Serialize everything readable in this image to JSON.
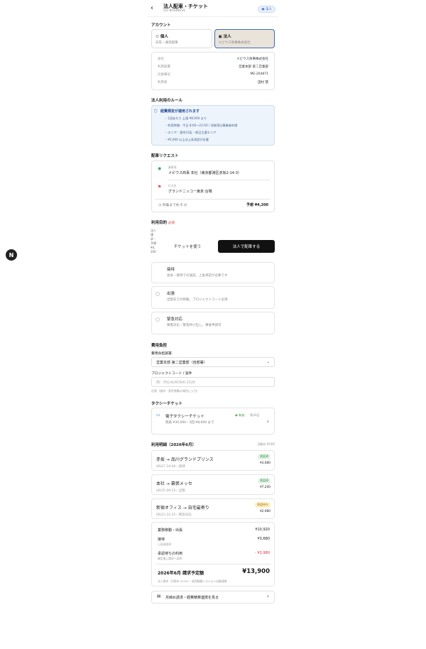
{
  "header": {
    "title": "法人配車・チケット",
    "subtitle": "GO BUSINESS",
    "badge": "法人"
  },
  "account": {
    "section": "アカウント",
    "personal_title": "個人",
    "personal_sub": "日常・通常配車",
    "corporate_title": "法人",
    "corporate_sub": "メビウス商事株式会社",
    "info": [
      {
        "k": "会社",
        "v": "メビウス商事株式会社"
      },
      {
        "k": "利用部署",
        "v": "営業本部 第二営業部"
      },
      {
        "k": "社員番号",
        "v": "ME-204871"
      },
      {
        "k": "利用者",
        "v": "田村 慧"
      }
    ]
  },
  "rules": {
    "section": "法人利用のルール",
    "title": "経費規定が適用されます",
    "items": [
      "・1回あたり 上限 ¥8,000 まで",
      "・利用時間：平日 8:00〜22:00 / 深夜帯は事業者申請",
      "・エリア：東京23区・周辺主要エリア",
      "・¥5,000 以上は上長承認が必要"
    ]
  },
  "request": {
    "section": "配車リクエスト",
    "pickup_label": "乗車地",
    "pickup": "メビウス商事 本社（東京都港区赤坂2-14-3）",
    "dest_label": "行き先",
    "dest": "グランドニッコー東京 台場",
    "eta": "到着まで約 6 分",
    "estimate": "予想 ¥4,200"
  },
  "purpose": {
    "section": "利用目的",
    "required": "必須",
    "side_text": "法人請求・予想 ¥4,200",
    "ticket_button": "チケットを使う",
    "corp_button": "法人で配車する",
    "options": [
      {
        "title": "接待",
        "sub": "会食・接待での送迎。上長承認が必要です"
      },
      {
        "title": "出張",
        "sub": "出張先での移動。プロジェクトコード必須"
      },
      {
        "title": "緊急対応",
        "sub": "障害対応・緊急呼び出し。事後申請可"
      }
    ]
  },
  "cost": {
    "section": "費用負担",
    "dept_label": "費用負担部署",
    "dept_value": "営業本部 第二営業部（自部署）",
    "project_label": "プロジェクトコード / 案件",
    "project_placeholder": "例：PRJ-AURORA-2026",
    "note": "任意（接待・案件移動の場合に入力）"
  },
  "ticket": {
    "section": "タクシーチケット",
    "title": "電子タクシーチケット",
    "status": "有効",
    "status_note": "残33日",
    "detail": "残高 ¥30,000・1回 ¥8,000 まで"
  },
  "history": {
    "section": "利用明細（2026年6月）",
    "right": "月締め 07/05",
    "items": [
      {
        "route": "赤坂 → 品川グランドプリンス",
        "meta": "06/27 19:40・接待",
        "status": "承認済",
        "amount": "¥3,680"
      },
      {
        "route": "本社 → 幕張メッセ",
        "meta": "06/25 09:12・出張",
        "status": "承認済",
        "amount": "¥7,240"
      },
      {
        "route": "新宿オフィス → 自宅最寄り",
        "meta": "06/23 22:35・緊急対応",
        "status": "承認待ち",
        "amount": "¥2,980"
      }
    ]
  },
  "summary": {
    "rows": [
      {
        "k": "業務移動・出張",
        "v": "¥10,920"
      },
      {
        "k": "接待",
        "v": "¥3,680"
      },
      {
        "k": "承認待ちの利用",
        "v": "- ¥2,980"
      }
    ],
    "sub1": "上長承認済",
    "sub2": "確定後に請求へ反映",
    "total_label": "2026年6月 請求予定額",
    "total": "¥13,900",
    "total_note": "法人請求（月締め 07/05）・経費精算システムへ自動連携",
    "link": "月締め請求・経費精算連携を見る"
  },
  "colors": {
    "accent": "#3d6cb5",
    "primary_button": "#111111"
  }
}
